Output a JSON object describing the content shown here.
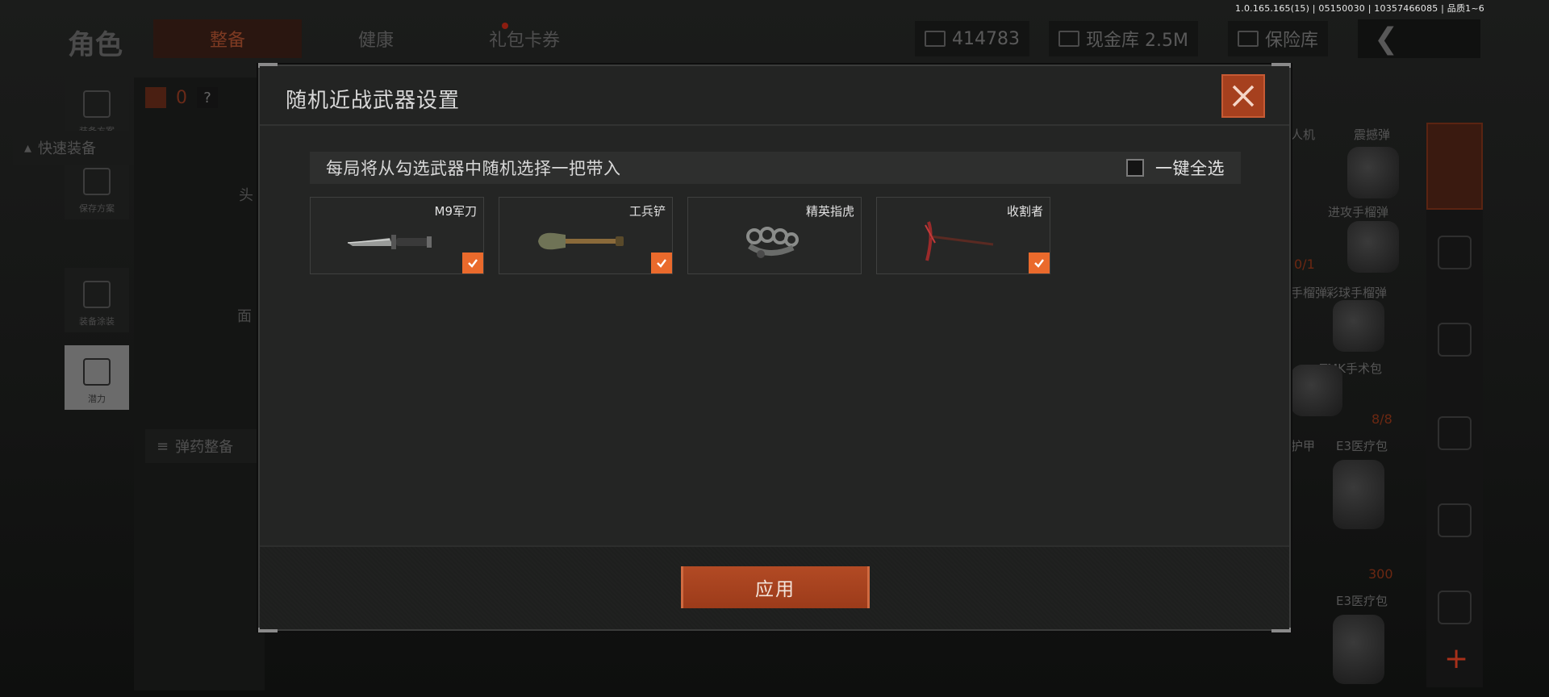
{
  "version": "1.0.165.165(15) | 05150030 | 10357466085 | 品质1~6",
  "background": {
    "page_title": "角色",
    "tabs": [
      {
        "label": "整备",
        "active": true
      },
      {
        "label": "健康",
        "active": false
      },
      {
        "label": "礼包卡券",
        "active": false,
        "notification": true
      }
    ],
    "currency_value": "414783",
    "cash_vault_label": "现金库 2.5M",
    "safe_label": "保险库",
    "left_nav": [
      "装备方案",
      "保存方案",
      "装备涂装",
      "潜力"
    ],
    "left_panel": {
      "count": "0",
      "quick_equip": "快速装备",
      "head_label": "头",
      "face_label": "面",
      "ammo_equip": "弹药整备"
    },
    "right_items": {
      "drone": "人机",
      "smoke": "震撼弹",
      "offensive_grenade": "进攻手榴弹",
      "smoke_grenade": "手榴弹",
      "color_grenade": "彩球手榴弹",
      "tmk": "TMK手术包",
      "count_a": "0/1",
      "count_b": "8/8",
      "armor": "护甲",
      "e3_medkit": "E3医疗包",
      "e3_medkit_2": "E3医疗包",
      "price": "300"
    }
  },
  "modal": {
    "title": "随机近战武器设置",
    "hint": "每局将从勾选武器中随机选择一把带入",
    "select_all_label": "一键全选",
    "select_all_checked": false,
    "weapons": [
      {
        "name": "M9军刀",
        "checked": true,
        "icon": "knife-icon"
      },
      {
        "name": "工兵铲",
        "checked": true,
        "icon": "shovel-icon"
      },
      {
        "name": "精英指虎",
        "checked": false,
        "icon": "brass-knuckles-icon"
      },
      {
        "name": "收割者",
        "checked": true,
        "icon": "pickaxe-icon"
      }
    ],
    "apply_label": "应用"
  },
  "colors": {
    "accent": "#ea6a2c",
    "apply_button": "#a8441f",
    "close_button": "#a6401e"
  }
}
